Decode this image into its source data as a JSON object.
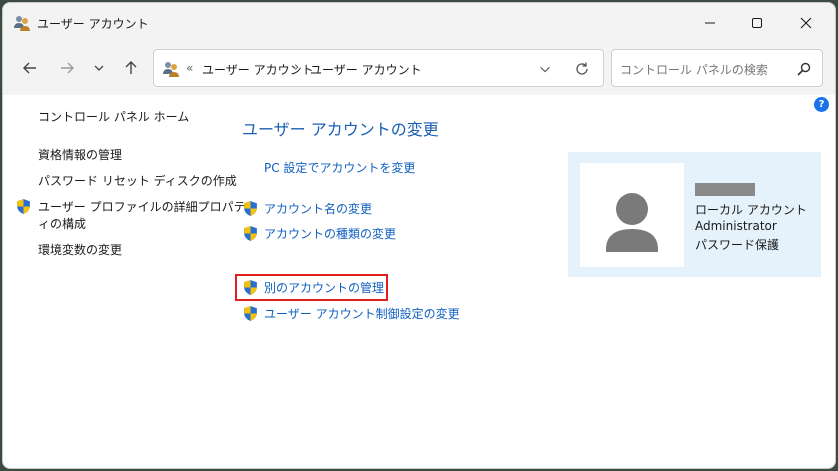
{
  "window": {
    "title": "ユーザー アカウント"
  },
  "navigation": {
    "back": "back-arrow",
    "forward": "forward-arrow",
    "recent": "chevron-down",
    "up": "up-arrow"
  },
  "address": {
    "overflow": "«",
    "crumbs": [
      "ユーザー アカウント",
      "ユーザー アカウント"
    ],
    "separator": "›"
  },
  "search": {
    "placeholder": "コントロール パネルの検索"
  },
  "sidebar": {
    "items": [
      {
        "label": "コントロール パネル ホーム",
        "shield": false
      },
      {
        "label": "資格情報の管理",
        "shield": false
      },
      {
        "label": "パスワード リセット ディスクの作成",
        "shield": false
      },
      {
        "label": "ユーザー プロファイルの詳細プロパテ",
        "label2": "ィの構成",
        "shield": true
      },
      {
        "label": "環境変数の変更",
        "shield": false
      }
    ]
  },
  "main": {
    "title": "ユーザー アカウントの変更",
    "tasks": [
      {
        "label": "PC 設定でアカウントを変更",
        "shield": false
      },
      {
        "label": "アカウント名の変更",
        "shield": true
      },
      {
        "label": "アカウントの種類の変更",
        "shield": true
      },
      {
        "label": "別のアカウントの管理",
        "shield": true,
        "highlighted": true
      },
      {
        "label": "ユーザー アカウント制御設定の変更",
        "shield": true
      }
    ]
  },
  "account": {
    "type": "ローカル アカウント",
    "role": "Administrator",
    "protection": "パスワード保護"
  },
  "colors": {
    "link": "#1060c0",
    "title": "#1a5fb4",
    "highlight": "#e0201e",
    "panel": "#e5f1fb"
  }
}
